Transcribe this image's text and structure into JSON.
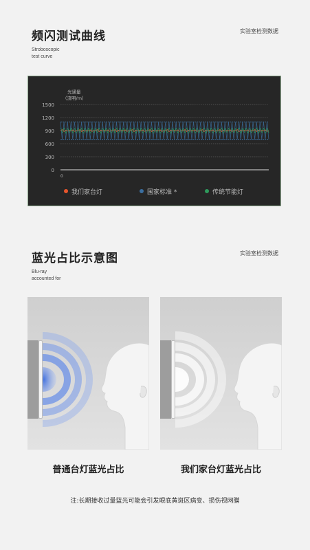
{
  "section1": {
    "title": "频闪测试曲线",
    "subtitle_line1": "Stroboscopic",
    "subtitle_line2": "test curve",
    "tag": "实验室检测数据"
  },
  "section2": {
    "title": "蓝光占比示意图",
    "subtitle_line1": "Blu-ray",
    "subtitle_line2": "accounted for",
    "tag": "实验室检测数据"
  },
  "chart_data": {
    "type": "line",
    "ylabel_line1": "光通量",
    "ylabel_line2": "（流明/m）",
    "yticks": [
      "1500",
      "1200",
      "900",
      "600",
      "300",
      "0"
    ],
    "ylim": [
      0,
      1500
    ],
    "x_origin_label": "0",
    "grid": true,
    "series": [
      {
        "name": "我们家台灯",
        "color": "#e8552c",
        "values": [
          900,
          920,
          880,
          910,
          890,
          905,
          895,
          915,
          885,
          900
        ]
      },
      {
        "name": "国家标准 *",
        "color": "#3b6fa0",
        "values": [
          1100,
          700,
          1100,
          700,
          1100,
          700,
          1100,
          700,
          1100,
          700
        ]
      },
      {
        "name": "传统节能灯",
        "color": "#2e9a5c",
        "values": [
          950,
          850,
          960,
          840,
          950,
          860,
          955,
          845,
          950,
          850
        ]
      }
    ],
    "legend_position": "bottom"
  },
  "illustrations": {
    "left_caption": "普通台灯蓝光占比",
    "right_caption": "我们家台灯蓝光占比",
    "left_ring_color": "#5b86e6",
    "right_ring_color": "#ffffff"
  },
  "note": "注:长期接收过量蓝光可能会引发眼底黄斑区病变、损伤视网膜"
}
